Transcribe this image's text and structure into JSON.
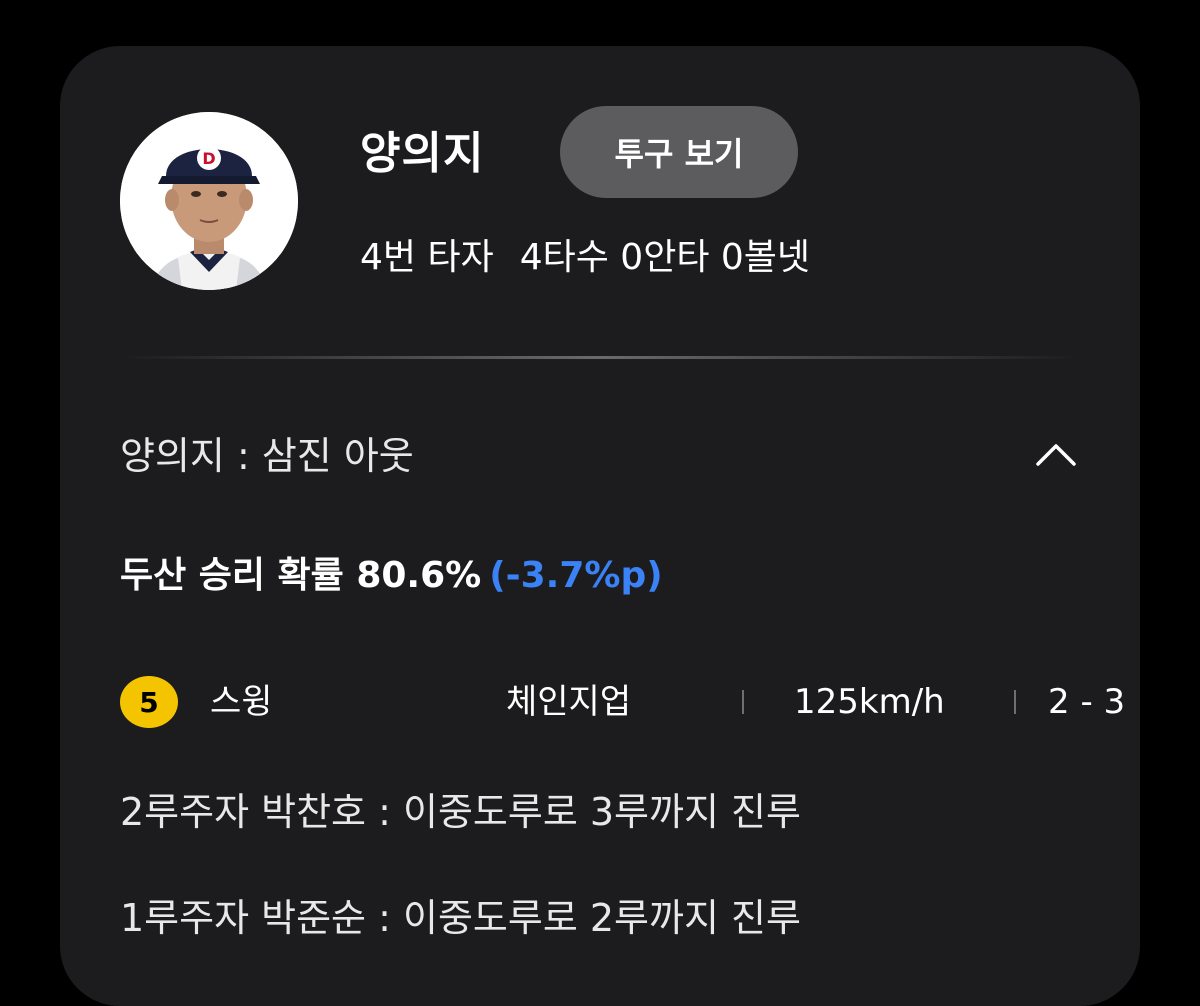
{
  "colors": {
    "background": "#000000",
    "card": "#1c1c1e",
    "button": "#5c5c5f",
    "accent_blue": "#3a82f6",
    "pitch_badge": "#f5c400"
  },
  "batter": {
    "name": "양의지",
    "view_pitch_label": "투구 보기",
    "order": "4번 타자",
    "stats": "4타수 0안타 0볼넷"
  },
  "result": {
    "text": "양의지 : 삼진 아웃",
    "toggle_icon": "chevron-up-icon"
  },
  "win_probability": {
    "text": "두산 승리 확률 80.6%",
    "delta": "(-3.7%p)"
  },
  "pitch": {
    "number": "5",
    "result": "스윙",
    "type": "체인지업",
    "speed": "125km/h",
    "count": "2 - 3"
  },
  "events": [
    "2루주자 박찬호 : 이중도루로 3루까지 진루",
    "1루주자 박준순 : 이중도루로 2루까지 진루"
  ]
}
